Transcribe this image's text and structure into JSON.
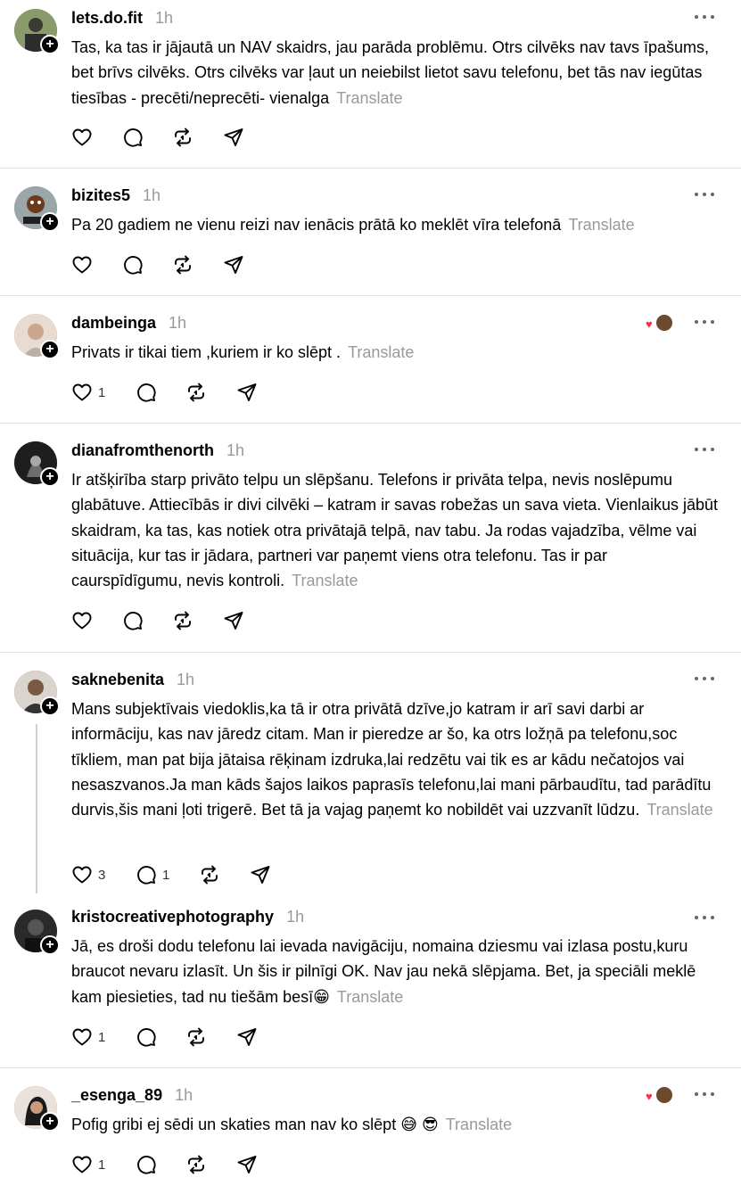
{
  "translate_label": "Translate",
  "icons": {
    "like": "heart-outline-icon",
    "reply": "comment-bubble-icon",
    "repost": "repost-icon",
    "share": "send-icon",
    "more": "more-horizontal-icon",
    "follow": "plus-icon"
  },
  "colors": {
    "meta_text": "#999999",
    "reaction_heart": "#ff2a55",
    "divider": "#e3e3e3"
  },
  "posts": [
    {
      "username": "lets.do.fit",
      "time": "1h",
      "text": "Tas, ka tas ir jājautā un NAV skaidrs, jau parāda problēmu. Otrs cilvēks nav tavs īpašums, bet brīvs cilvēks. Otrs cilvēks var ļaut un neiebilst lietot savu telefonu, bet tās nav iegūtas tiesības - precēti/neprecēti- vienalga",
      "likes": "",
      "replies": ""
    },
    {
      "username": "bizites5",
      "time": "1h",
      "text": "Pa 20 gadiem ne vienu reizi nav ienācis prātā ko meklēt vīra telefonā",
      "likes": "",
      "replies": ""
    },
    {
      "username": "dambeinga",
      "time": "1h",
      "text": "Privats ir tikai tiem ,kuriem ir ko slēpt .",
      "likes": "1",
      "replies": ""
    },
    {
      "username": "dianafromthenorth",
      "time": "1h",
      "text": "Ir atšķirība starp privāto telpu un slēpšanu. Telefons ir privāta telpa, nevis noslēpumu glabātuve. Attiecībās ir divi cilvēki – katram ir savas robežas un sava vieta. Vienlaikus jābūt skaidram, ka tas, kas notiek otra privātajā telpā, nav tabu. Ja rodas vajadzība, vēlme vai situācija, kur tas ir jādara, partneri var paņemt viens otra telefonu. Tas ir par caurspīdīgumu, nevis kontroli.",
      "likes": "",
      "replies": ""
    },
    {
      "username": "saknebenita",
      "time": "1h",
      "text": "Mans subjektīvais viedoklis,ka tā ir otra privātā dzīve,jo katram ir arī savi darbi ar informāciju, kas nav jāredz citam. Man ir pieredze ar šo, ka otrs ložņā pa telefonu,soc tīkliem, man pat bija jātaisa rēķinam izdruka,lai redzētu vai tik es ar kādu nečatojos vai nesaszvanos.Ja man kāds šajos laikos paprasīs telefonu,lai mani pārbaudītu, tad parādītu durvis,šis mani ļoti trigerē. Bet tā ja vajag paņemt ko nobildēt vai uzzvanīt lūdzu.",
      "likes": "3",
      "replies": "1"
    },
    {
      "username": "kristocreativephotography",
      "time": "1h",
      "text": "Jā, es droši dodu telefonu lai ievada navigāciju, nomaina dziesmu vai izlasa postu,kuru braucot nevaru izlasīt. Un šis ir pilnīgi OK. Nav jau nekā slēpjama. Bet, ja speciāli meklē kam piesieties, tad nu tiešām besī😁",
      "likes": "1",
      "replies": ""
    },
    {
      "username": "_esenga_89",
      "time": "1h",
      "text": "Pofig gribi ej sēdi un skaties man nav ko slēpt 😅 😎",
      "likes": "1",
      "replies": ""
    }
  ]
}
